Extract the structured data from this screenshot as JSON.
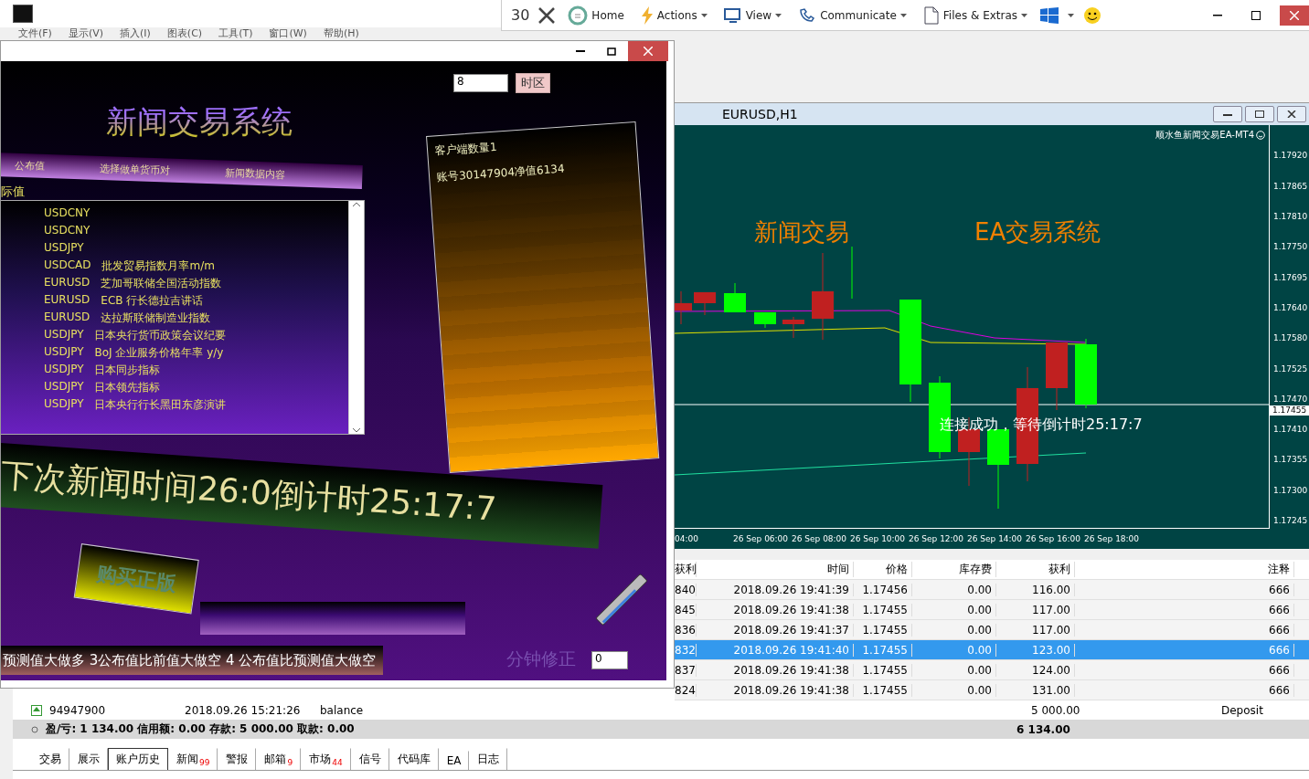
{
  "menu": [
    "文件(F)",
    "显示(V)",
    "插入(I)",
    "图表(C)",
    "工具(T)",
    "窗口(W)",
    "帮助(H)"
  ],
  "toolbar": {
    "count": "30",
    "items": [
      {
        "label": "Home",
        "kind": "home",
        "dropdown": false
      },
      {
        "label": "Actions",
        "kind": "actions",
        "dropdown": true
      },
      {
        "label": "View",
        "kind": "view",
        "dropdown": true
      },
      {
        "label": "Communicate",
        "kind": "communicate",
        "dropdown": true
      },
      {
        "label": "Files & Extras",
        "kind": "files",
        "dropdown": true
      }
    ]
  },
  "ea_window": {
    "timezone_value": "8",
    "timezone_button": "时区",
    "title": "新闻交易系统",
    "headers": [
      "公布值",
      "选择做单货币对",
      "新闻数据内容"
    ],
    "side_label": "际值",
    "news": [
      {
        "pair": "USDCNY"
      },
      {
        "pair": "USDCNY"
      },
      {
        "pair": "USDJPY"
      },
      {
        "pair": "USDCAD",
        "event": "批发贸易指数月率m/m"
      },
      {
        "pair": "EURUSD",
        "event": "芝加哥联储全国活动指数"
      },
      {
        "pair": "EURUSD",
        "event": "ECB 行长德拉吉讲话"
      },
      {
        "pair": "EURUSD",
        "event": "达拉斯联储制造业指数"
      },
      {
        "pair": "USDJPY",
        "event": "日本央行货币政策会议纪要"
      },
      {
        "pair": "USDJPY",
        "event": "BoJ 企业服务价格年率 y/y"
      },
      {
        "pair": "USDJPY",
        "event": "日本同步指标"
      },
      {
        "pair": "USDJPY",
        "event": "日本领先指标"
      },
      {
        "pair": "USDJPY",
        "event": "日本央行行长黑田东彦演讲"
      }
    ],
    "info": [
      "客户端数量1",
      "账号30147904净值6134"
    ],
    "countdown": "下次新闻时间26:0倒计时25:17:7",
    "buy_button": "购买正版",
    "rules": "预测值大做多  3公布值比前值大做空 4 公布值比预测值大做空",
    "minute_label": "分钟修正",
    "minute_value": "0"
  },
  "chart_window": {
    "title": "EURUSD,H1",
    "indicator": "顺水鱼新闻交易EA-MT4",
    "headline_left": "新闻交易",
    "headline_right": "EA交易系统",
    "status": "连接成功，等待倒计时25:17:7",
    "current_price": "1.17455",
    "price_ticks": [
      "1.17920",
      "1.17865",
      "1.17810",
      "1.17750",
      "1.17695",
      "1.17640",
      "1.17580",
      "1.17525",
      "1.17470",
      "1.17410",
      "1.17355",
      "1.17300",
      "1.17245"
    ],
    "time_ticks": [
      "04:00",
      "26 Sep 06:00",
      "26 Sep 08:00",
      "26 Sep 10:00",
      "26 Sep 12:00",
      "26 Sep 14:00",
      "26 Sep 16:00",
      "26 Sep 18:00"
    ]
  },
  "terminal": {
    "columns": [
      "获利",
      "时间",
      "价格",
      "库存费",
      "获利",
      "注释"
    ],
    "rows": [
      {
        "cells": [
          "840",
          "2018.09.26 19:41:39",
          "1.17456",
          "0.00",
          "116.00",
          "666"
        ],
        "selected": false
      },
      {
        "cells": [
          "845",
          "2018.09.26 19:41:38",
          "1.17455",
          "0.00",
          "117.00",
          "666"
        ],
        "selected": false
      },
      {
        "cells": [
          "836",
          "2018.09.26 19:41:37",
          "1.17455",
          "0.00",
          "117.00",
          "666"
        ],
        "selected": false
      },
      {
        "cells": [
          "832",
          "2018.09.26 19:41:40",
          "1.17455",
          "0.00",
          "123.00",
          "666"
        ],
        "selected": true
      },
      {
        "cells": [
          "837",
          "2018.09.26 19:41:38",
          "1.17455",
          "0.00",
          "124.00",
          "666"
        ],
        "selected": false
      },
      {
        "cells": [
          "824",
          "2018.09.26 19:41:38",
          "1.17455",
          "0.00",
          "131.00",
          "666"
        ],
        "selected": false
      }
    ],
    "balance": {
      "ticket": "94947900",
      "time": "2018.09.26 15:21:26",
      "type": "balance",
      "amount": "5 000.00",
      "comment": "Deposit"
    },
    "summary": "盈/亏: 1 134.00  信用额: 0.00  存款: 5 000.00  取款: 0.00",
    "total": "6 134.00",
    "tabs": [
      {
        "label": "交易",
        "selected": false
      },
      {
        "label": "展示",
        "selected": false
      },
      {
        "label": "账户历史",
        "selected": true
      },
      {
        "label": "新闻",
        "badge": "99",
        "selected": false
      },
      {
        "label": "警报",
        "selected": false
      },
      {
        "label": "邮箱",
        "badge": "9",
        "selected": false
      },
      {
        "label": "市场",
        "badge": "44",
        "selected": false
      },
      {
        "label": "信号",
        "selected": false
      },
      {
        "label": "代码库",
        "selected": false
      },
      {
        "label": "EA",
        "selected": false
      },
      {
        "label": "日志",
        "selected": false
      }
    ]
  }
}
